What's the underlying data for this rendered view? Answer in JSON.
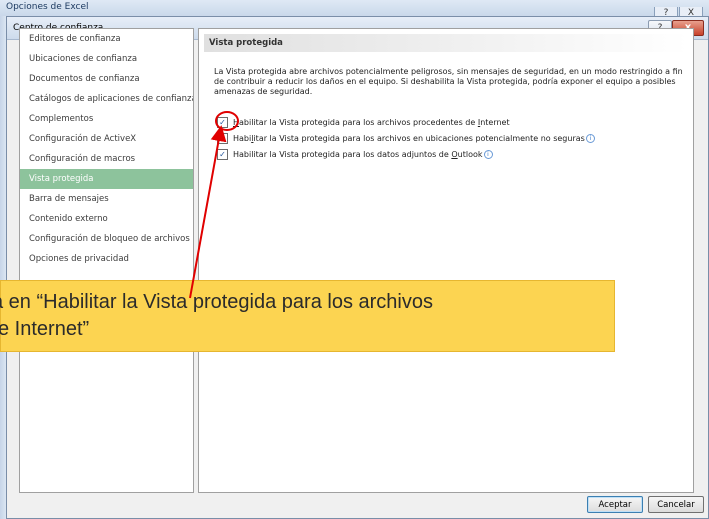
{
  "outer_window": {
    "title": "Opciones de Excel",
    "help_label": "?",
    "close_label": "X"
  },
  "dialog": {
    "title": "Centro de confianza",
    "help_label": "?",
    "close_label": "x"
  },
  "nav": {
    "items": [
      {
        "label": "Editores de confianza"
      },
      {
        "label": "Ubicaciones de confianza"
      },
      {
        "label": "Documentos de confianza"
      },
      {
        "label": "Catálogos de aplicaciones de confianza"
      },
      {
        "label": "Complementos"
      },
      {
        "label": "Configuración de ActiveX"
      },
      {
        "label": "Configuración de macros"
      },
      {
        "label": "Vista protegida",
        "selected": true
      },
      {
        "label": "Barra de mensajes"
      },
      {
        "label": "Contenido externo"
      },
      {
        "label": "Configuración de bloqueo de archivos"
      },
      {
        "label": "Opciones de privacidad"
      }
    ]
  },
  "panel": {
    "header": "Vista protegida",
    "description": "La Vista protegida abre archivos potencialmente peligrosos, sin mensajes de seguridad, en un modo restringido a fin de contribuir a reducir los daños en el equipo. Si deshabilita la Vista protegida, podría exponer el equipo a posibles amenazas de seguridad.",
    "options": [
      {
        "pre": "",
        "ul": "H",
        "post": "abilitar la Vista protegida para los archivos procedentes de ",
        "ul2": "I",
        "post2": "nternet",
        "checked": true
      },
      {
        "pre": "Habi",
        "ul": "l",
        "post": "itar la Vista protegida para los archivos en ubicaciones potencialmente no seguras",
        "ul2": "",
        "post2": "",
        "checked": true,
        "info": true
      },
      {
        "pre": "Habilitar la Vista protegida para los datos adjuntos de ",
        "ul": "O",
        "post": "utlook",
        "ul2": "",
        "post2": "",
        "checked": true,
        "info": true
      }
    ]
  },
  "buttons": {
    "accept": "Aceptar",
    "cancel": "Cancelar"
  },
  "callout": {
    "line1": "a en “Habilitar la Vista protegida para los archivos",
    "line2": "e Internet”"
  },
  "colors": {
    "selected_nav": "#8dc39c",
    "callout_bg": "#fcd451",
    "annotation_red": "#e00000"
  }
}
